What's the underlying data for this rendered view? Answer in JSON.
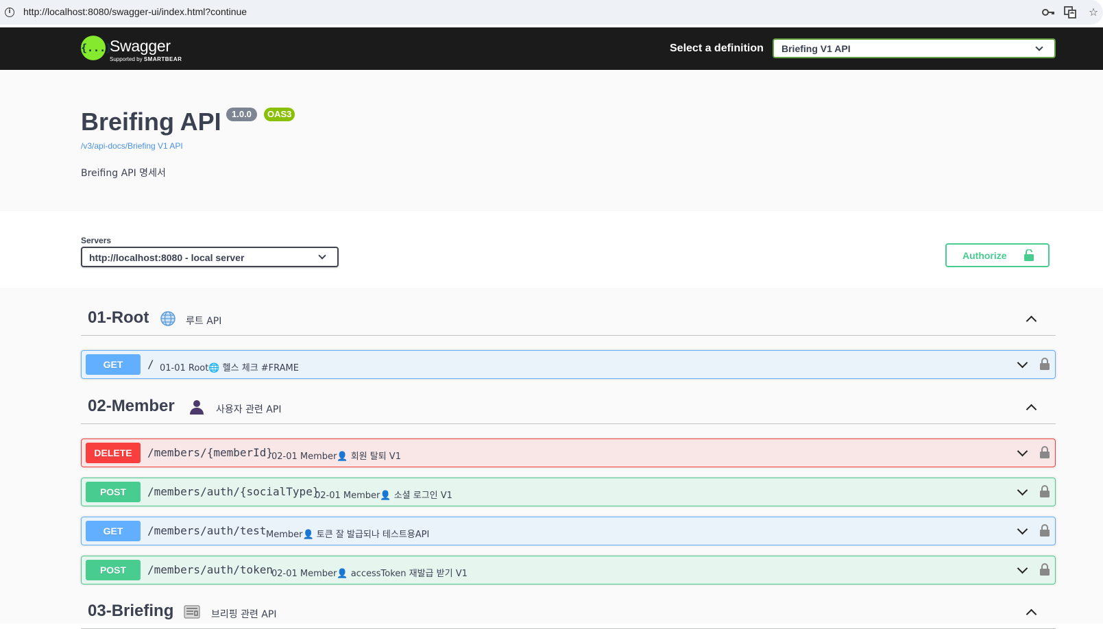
{
  "browser": {
    "url": "http://localhost:8080/swagger-ui/index.html?continue",
    "icons": [
      "info-icon",
      "key-icon",
      "translate-icon",
      "star-icon"
    ]
  },
  "topbar": {
    "logo_text": "Swagger",
    "logo_glyph": "{...}",
    "logo_sub_prefix": "Supported by",
    "logo_sub_brand": "SMARTBEAR",
    "select_label": "Select a definition",
    "definition_value": "Briefing V1 API"
  },
  "info": {
    "title": "Breifing API",
    "version": "1.0.0",
    "oas": "OAS3",
    "link": "/v3/api-docs/Briefing V1 API",
    "description": "Breifing API 명세서"
  },
  "scheme": {
    "servers_label": "Servers",
    "server_value": "http://localhost:8080 - local server",
    "authorize_label": "Authorize"
  },
  "tags": [
    {
      "name": "01-Root",
      "icon": "globe-icon",
      "description": "루트 API",
      "operations": [
        {
          "method": "GET",
          "path": "/",
          "summary": "01-01 Root🌐 헬스 체크 #FRAME"
        }
      ]
    },
    {
      "name": "02-Member",
      "icon": "user-icon",
      "description": "사용자 관련 API",
      "operations": [
        {
          "method": "DELETE",
          "path": "/members/{memberId}",
          "summary": "02-01 Member👤 회원 탈퇴 V1"
        },
        {
          "method": "POST",
          "path": "/members/auth/{socialType}",
          "summary": "02-01 Member👤 소셜 로그인 V1"
        },
        {
          "method": "GET",
          "path": "/members/auth/test",
          "summary": "Member👤 토큰 잘 발급되나 테스트용API"
        },
        {
          "method": "POST",
          "path": "/members/auth/token",
          "summary": "02-01 Member👤 accessToken 재발급 받기 V1"
        }
      ]
    },
    {
      "name": "03-Briefing",
      "icon": "newspaper-icon",
      "description": "브리핑 관련 API",
      "operations": []
    }
  ],
  "colors": {
    "get": "#61affe",
    "post": "#49cc90",
    "delete": "#f93e3e",
    "topbar": "#1b1b1b",
    "swagger_green": "#85ea2d"
  }
}
